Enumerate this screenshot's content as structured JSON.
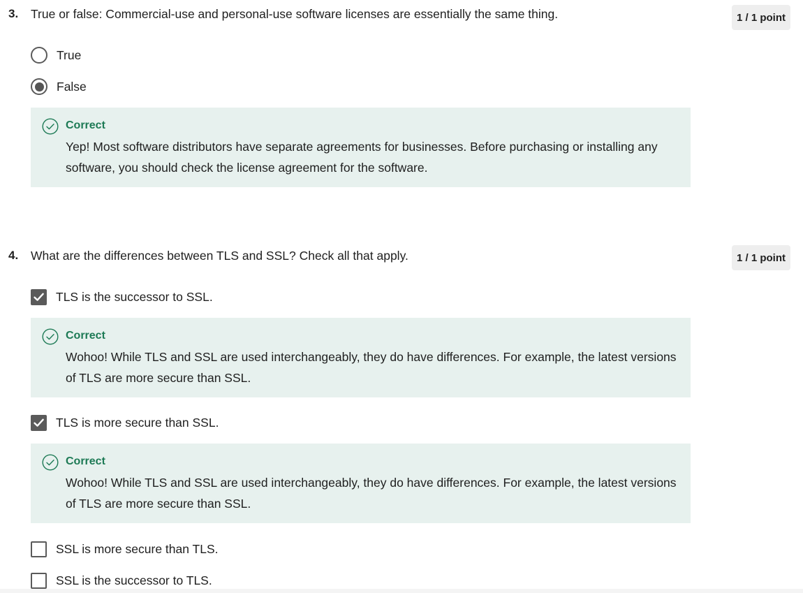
{
  "questions": [
    {
      "number": "3.",
      "text": "True or false: Commercial-use and personal-use software licenses are essentially the same thing.",
      "score": "1 / 1 point",
      "options": [
        {
          "label": "True",
          "selected": false
        },
        {
          "label": "False",
          "selected": true
        }
      ],
      "feedback": {
        "title": "Correct",
        "text": "Yep! Most software distributors have separate agreements for businesses. Before purchasing or installing any software, you should check the license agreement for the software."
      }
    },
    {
      "number": "4.",
      "text": "What are the differences between TLS and SSL? Check all that apply.",
      "score": "1 / 1 point",
      "options": [
        {
          "label": "TLS is the successor to SSL.",
          "checked": true,
          "feedback": {
            "title": "Correct",
            "text": "Wohoo! While TLS and SSL are used interchangeably, they do have differences. For example, the latest versions of TLS are more secure than SSL."
          }
        },
        {
          "label": "TLS is more secure than SSL.",
          "checked": true,
          "feedback": {
            "title": "Correct",
            "text": "Wohoo! While TLS and SSL are used interchangeably, they do have differences. For example, the latest versions of TLS are more secure than SSL."
          }
        },
        {
          "label": "SSL is more secure than TLS.",
          "checked": false
        },
        {
          "label": "SSL is the successor to TLS.",
          "checked": false
        }
      ]
    }
  ],
  "colors": {
    "correct_green": "#1d7a55",
    "feedback_bg": "#e7f1ee",
    "control_gray": "#5a5a5a",
    "badge_bg": "#eeeeee"
  },
  "icons": {
    "feedback": "check-circle-icon",
    "checkbox_checked": "checkmark-icon"
  }
}
